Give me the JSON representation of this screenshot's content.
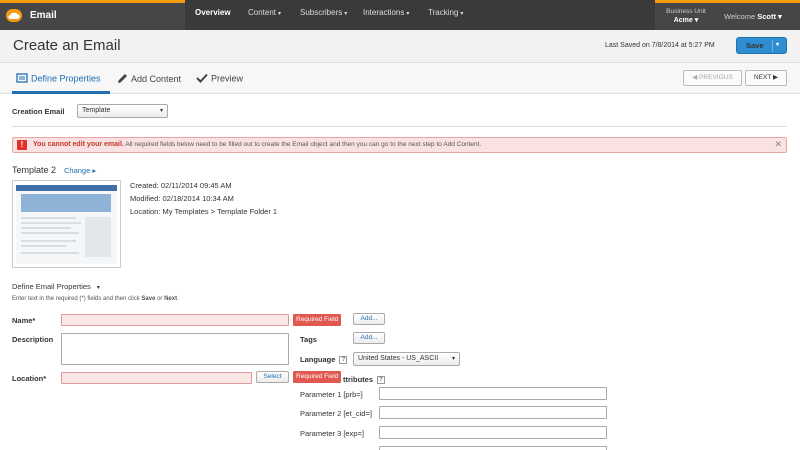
{
  "topnav": {
    "app_title": "Email",
    "items": [
      {
        "label": "Overview",
        "caret": ""
      },
      {
        "label": "Content",
        "caret": "▾"
      },
      {
        "label": "Subscribers",
        "caret": "▾"
      },
      {
        "label": "Interactions",
        "caret": "▾"
      },
      {
        "label": "Tracking",
        "caret": "▾"
      }
    ],
    "business_unit_label": "Business Unit",
    "business_unit_value": "Acme ▾",
    "welcome": "Welcome",
    "user": "Scott ▾"
  },
  "header": {
    "title": "Create an Email",
    "last_saved": "Last Saved on 7/8/2014 at 5:27 PM",
    "save_label": "Save",
    "save_arrow": "▾"
  },
  "steps": {
    "items": [
      "Define Properties",
      "Add Content",
      "Preview"
    ],
    "previous": "◀ PREVIOUS",
    "next": "NEXT ▶"
  },
  "creation": {
    "label": "Creation Email",
    "value": "Template",
    "arrow": "▾"
  },
  "alert": {
    "icon": "!",
    "bold": "You cannot edit your email.",
    "text": " All required fields below need to be filled out to create the Email object and then you can go to the next step to Add Content.",
    "close": "✕"
  },
  "template": {
    "name": "Template 2",
    "change": "Change ▸",
    "created": "Created: 02/11/2014 09:45 AM",
    "modified": "Modified: 02/18/2014 10:34 AM",
    "location": "Location: My Templates > Template Folder 1"
  },
  "props": {
    "section": "Define Email Properties",
    "section_arrow": "▾",
    "instructions_pre": "Enter text in the required (*) fields and then click ",
    "instructions_save": "Save",
    "instructions_or": " or ",
    "instructions_next": "Next",
    "instructions_end": ".",
    "name_label": "Name*",
    "required": "Required Field",
    "add": "Add...",
    "description_label": "Description",
    "tags_label": "Tags",
    "language_label": "Language",
    "help": "?",
    "language_value": "United States - US_ASCII",
    "location_label": "Location*",
    "select": "Select",
    "attributes_label": "ttributes",
    "params": [
      "Parameter 1 [prb=]",
      "Parameter 2 [et_cid=]",
      "Parameter 3 [exp=]"
    ]
  }
}
